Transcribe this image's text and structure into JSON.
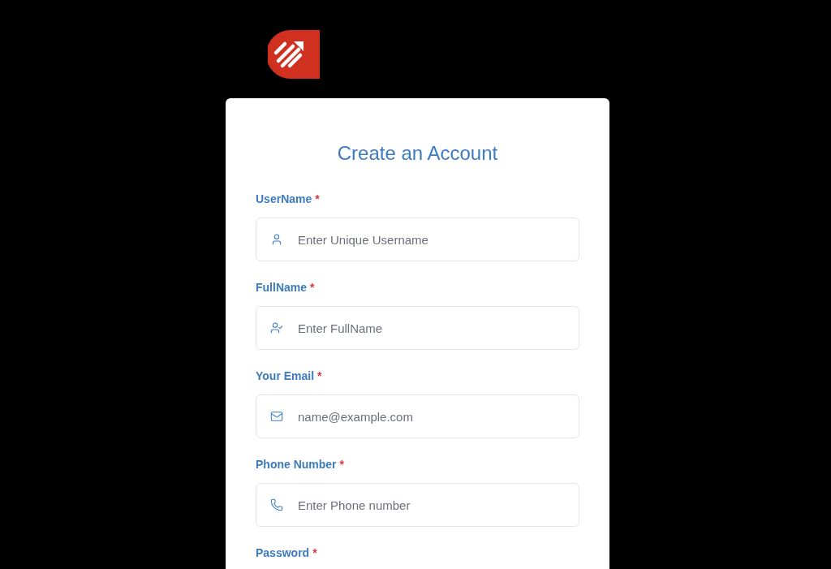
{
  "title": "Create an Account",
  "fields": [
    {
      "label": "UserName",
      "required_mark": "*",
      "kind": "user",
      "placeholder": "Enter Unique Username"
    },
    {
      "label": "FullName",
      "required_mark": "*",
      "kind": "user-check",
      "placeholder": "Enter FullName"
    },
    {
      "label": "Your Email",
      "required_mark": "*",
      "kind": "mail",
      "placeholder": "name@example.com"
    },
    {
      "label": "Phone Number",
      "required_mark": "*",
      "kind": "phone",
      "placeholder": "Enter Phone number"
    },
    {
      "label": "Password",
      "required_mark": "*",
      "kind": "password"
    }
  ]
}
